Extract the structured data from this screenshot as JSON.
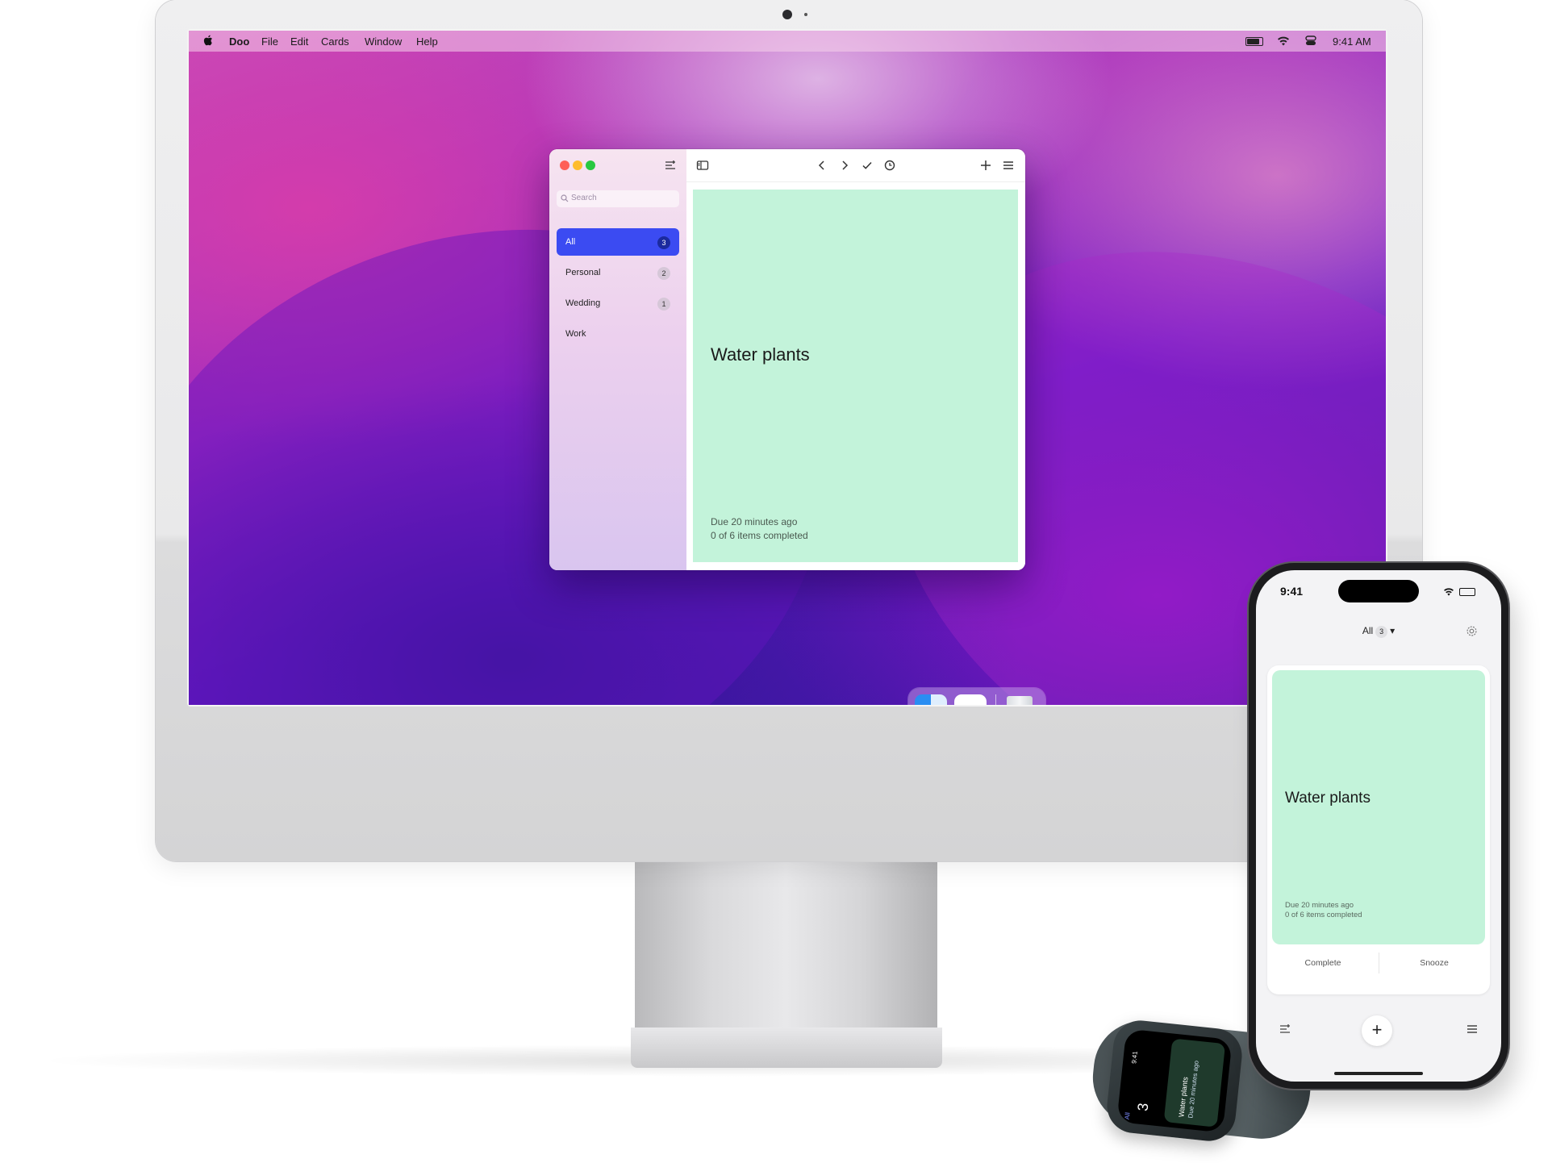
{
  "menubar": {
    "app_name": "Doo",
    "items": [
      "File",
      "Edit",
      "Cards",
      "Window",
      "Help"
    ],
    "clock": "9:41 AM"
  },
  "window": {
    "search_placeholder": "Search",
    "lists": [
      {
        "label": "All",
        "count": "3",
        "active": true
      },
      {
        "label": "Personal",
        "count": "2"
      },
      {
        "label": "Wedding",
        "count": "1"
      },
      {
        "label": "Work",
        "count": ""
      }
    ],
    "card": {
      "title": "Water plants",
      "due": "Due 20 minutes ago",
      "progress": "0 of 6 items completed",
      "color": "#c3f3da"
    },
    "accent": "#3b4bf2",
    "toolbar_icons": [
      "sidebar-toggle-icon",
      "chevron-left-icon",
      "chevron-right-icon",
      "checkmark-icon",
      "snooze-clock-icon",
      "plus-icon",
      "menu-icon"
    ]
  },
  "phone": {
    "time": "9:41",
    "list_label": "All",
    "list_count": "3",
    "card": {
      "title": "Water plants",
      "due": "Due 20 minutes ago",
      "progress": "0 of 6 items completed"
    },
    "actions": {
      "complete": "Complete",
      "snooze": "Snooze"
    }
  },
  "watch": {
    "time": "9:41",
    "list_label": "All",
    "count": "3",
    "card_title": "Water plants",
    "card_due": "Due 20 minutes ago"
  }
}
